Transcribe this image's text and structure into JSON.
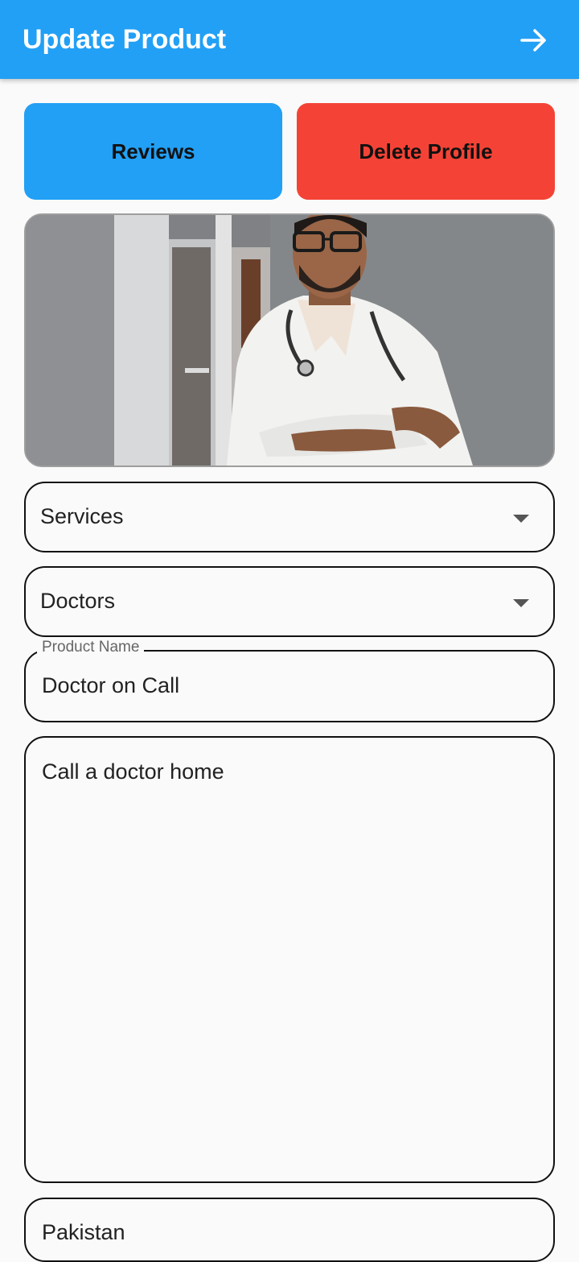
{
  "appbar": {
    "title": "Update Product",
    "action_icon": "arrow-right-icon"
  },
  "buttons": {
    "reviews": "Reviews",
    "delete_profile": "Delete Profile"
  },
  "form": {
    "category": "Services",
    "subcategory": "Doctors",
    "product_name": {
      "label": "Product Name",
      "value": "Doctor on Call"
    },
    "description": "Call a doctor home",
    "location": "Pakistan"
  },
  "colors": {
    "appbar": "#22a0f5",
    "reviews_button": "#22a0f5",
    "delete_button": "#f44336",
    "background": "#fafafa"
  }
}
